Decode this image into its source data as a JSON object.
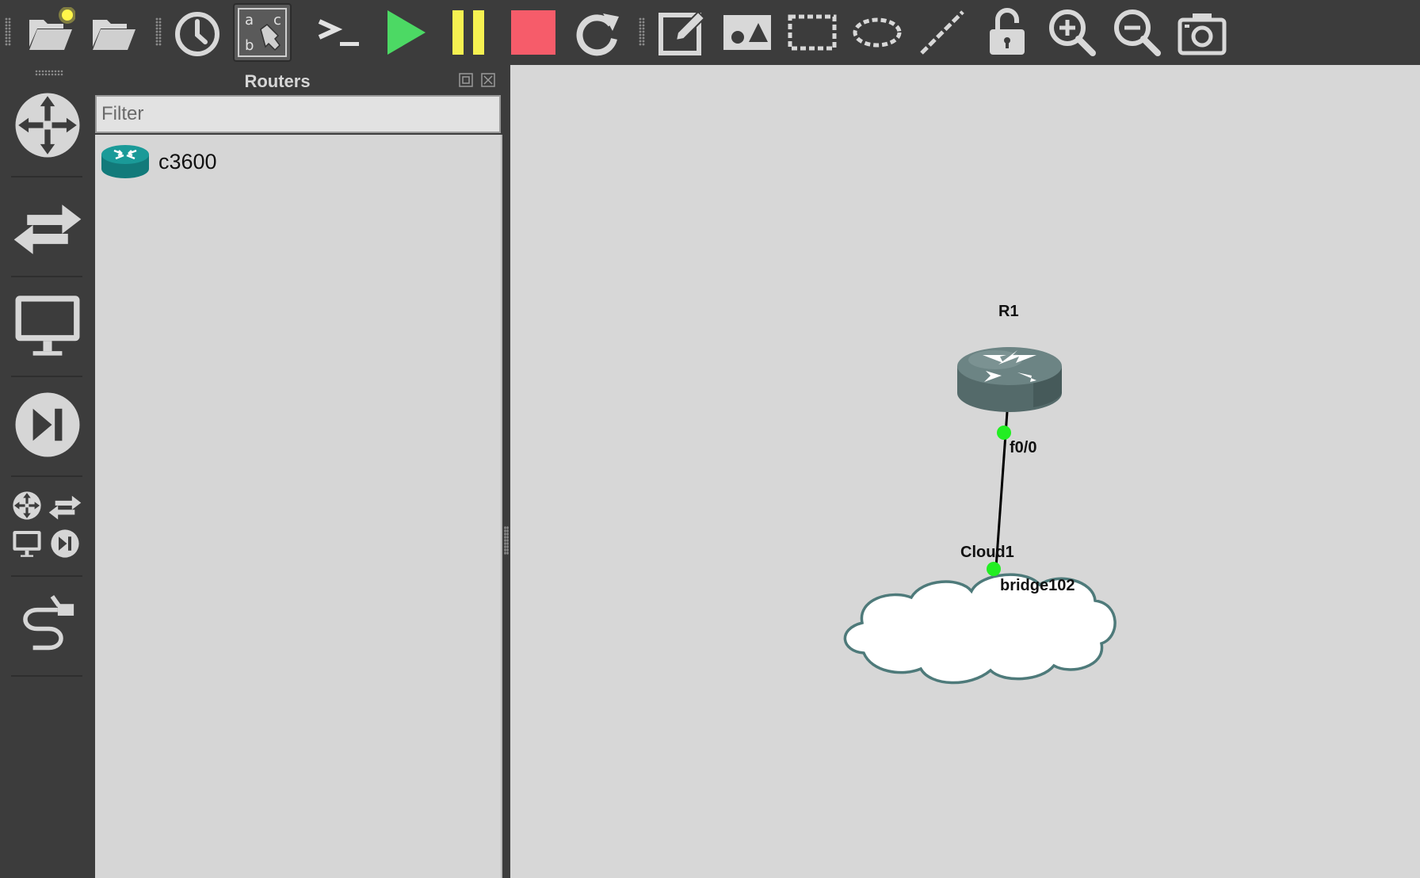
{
  "toolbar": {
    "buttons": [
      {
        "name": "new-project",
        "icon": "folder-open-new-icon"
      },
      {
        "name": "open-project",
        "icon": "folder-open-icon"
      },
      {
        "name": "snapshot",
        "icon": "clock-icon"
      },
      {
        "name": "show-interface-labels",
        "icon": "abc-label-icon",
        "active": true
      },
      {
        "name": "console-all",
        "icon": "terminal-icon",
        "text": ">_"
      },
      {
        "name": "start-all",
        "icon": "play-icon"
      },
      {
        "name": "suspend-all",
        "icon": "pause-icon"
      },
      {
        "name": "stop-all",
        "icon": "stop-icon"
      },
      {
        "name": "reload-all",
        "icon": "reload-icon"
      },
      {
        "name": "add-note",
        "icon": "edit-note-icon"
      },
      {
        "name": "insert-picture",
        "icon": "picture-icon"
      },
      {
        "name": "draw-rectangle",
        "icon": "rectangle-icon"
      },
      {
        "name": "draw-ellipse",
        "icon": "ellipse-icon"
      },
      {
        "name": "draw-line",
        "icon": "line-icon"
      },
      {
        "name": "lock-items",
        "icon": "unlock-icon"
      },
      {
        "name": "zoom-in",
        "icon": "zoom-in-icon"
      },
      {
        "name": "zoom-out",
        "icon": "zoom-out-icon"
      },
      {
        "name": "screenshot",
        "icon": "camera-icon"
      }
    ]
  },
  "device_bar": {
    "categories": [
      {
        "name": "routers",
        "icon": "router-arrows-icon"
      },
      {
        "name": "switches",
        "icon": "switch-arrows-icon"
      },
      {
        "name": "end-devices",
        "icon": "monitor-icon"
      },
      {
        "name": "security-devices",
        "icon": "skip-icon"
      },
      {
        "name": "all-devices",
        "icon": "all-devices-icon"
      },
      {
        "name": "add-link",
        "icon": "cable-icon"
      }
    ]
  },
  "panel": {
    "title": "Routers",
    "filter_placeholder": "Filter",
    "items": [
      {
        "label": "c3600",
        "icon": "router-icon"
      }
    ]
  },
  "topology": {
    "nodes": [
      {
        "label": "R1",
        "type": "router",
        "icon": "router-icon"
      },
      {
        "label": "Cloud1",
        "type": "cloud",
        "icon": "cloud-icon"
      }
    ],
    "links": [
      {
        "port_a": "f0/0",
        "port_b": "bridge102",
        "status": "up"
      }
    ]
  },
  "colors": {
    "toolbar_bg": "#3c3c3c",
    "canvas_bg": "#d7d7d7",
    "play": "#4cd964",
    "pause": "#f6f151",
    "stop": "#f65c6a",
    "port_up": "#22ee22",
    "router_body": "#546a6a",
    "router_panel_icon": "#1a8a8a"
  }
}
